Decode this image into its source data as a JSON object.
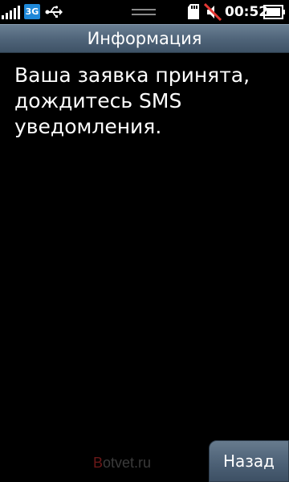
{
  "status_bar": {
    "network_type": "3G",
    "time": "00:52",
    "icons": [
      "signal-icon",
      "usb-icon",
      "handle-icon",
      "sd-card-icon",
      "mute-icon",
      "battery-icon"
    ]
  },
  "title": "Информация",
  "message": "Ваша заявка принята, дождитесь SMS уведомления.",
  "watermark": {
    "prefix": "B",
    "rest": "otvet.ru"
  },
  "back_button": {
    "label": "Назад"
  },
  "colors": {
    "accent": "#1e88d8",
    "bar": "#4e6378",
    "background": "#000000",
    "mute_slash": "#e53935"
  }
}
